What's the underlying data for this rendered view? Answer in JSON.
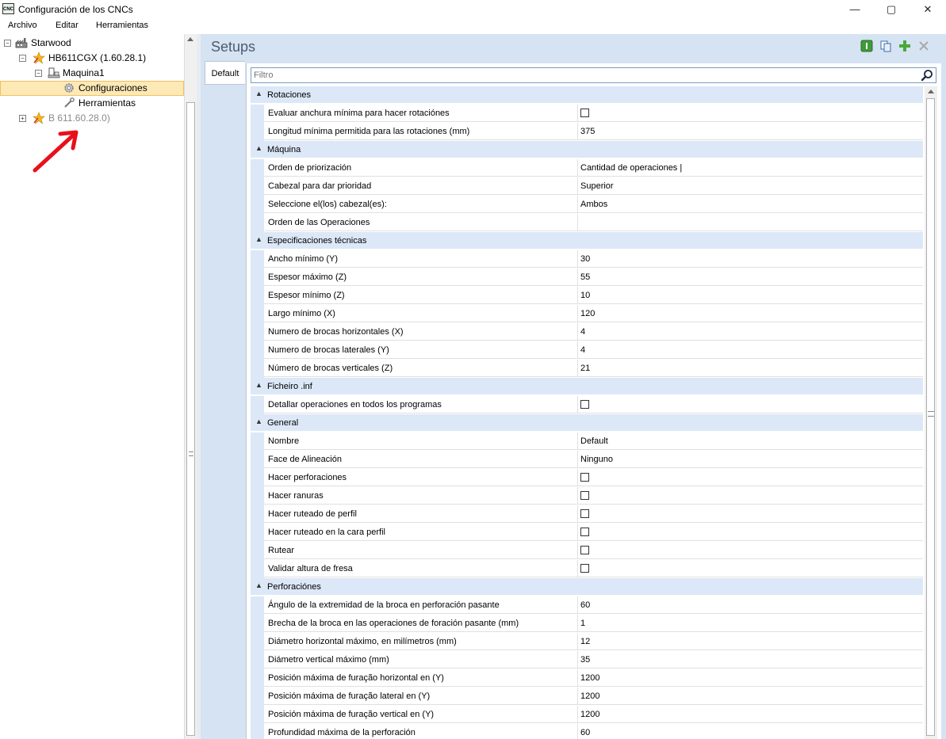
{
  "window": {
    "title": "Configuración de los CNCs",
    "icon_text": "CNC",
    "buttons": {
      "minimize": "—",
      "maximize": "▢",
      "close": "✕"
    }
  },
  "menu": {
    "items": [
      "Archivo",
      "Editar",
      "Herramientas"
    ]
  },
  "tree": {
    "nodes": [
      {
        "label": "Starwood",
        "icon": "factory-icon",
        "expander": "−"
      },
      {
        "label": "HB611CGX (1.60.28.1)",
        "icon": "star-icon",
        "expander": "−"
      },
      {
        "label": "Maquina1",
        "icon": "machine-icon",
        "expander": "−"
      },
      {
        "label": "Configuraciones",
        "icon": "gear-icon",
        "selected": true
      },
      {
        "label": "Herramientas",
        "icon": "tools-icon"
      },
      {
        "label": "B 611.60.28.0)",
        "icon": "star-icon",
        "expander": "+",
        "dimmed": true
      }
    ]
  },
  "panel": {
    "title": "Setups",
    "tab": "Default",
    "filter_placeholder": "Filtro",
    "header_icons": [
      "info-icon",
      "copy-icon",
      "add-icon",
      "delete-icon"
    ]
  },
  "sections": [
    {
      "title": "Rotaciones",
      "rows": [
        {
          "name": "Evaluar anchura mínima para hacer rotaciónes",
          "checkbox": true,
          "checked": false
        },
        {
          "name": "Longitud mínima permitida para las rotaciones (mm)",
          "value": "375"
        }
      ]
    },
    {
      "title": "Máquina",
      "rows": [
        {
          "name": "Orden de priorización",
          "value": "Cantidad de operaciones |"
        },
        {
          "name": "Cabezal para dar prioridad",
          "value": "Superior"
        },
        {
          "name": "Seleccione el(los) cabezal(es):",
          "value": "Ambos"
        },
        {
          "name": "Orden de las Operaciones",
          "value": ""
        }
      ]
    },
    {
      "title": "Especificaciones técnicas",
      "rows": [
        {
          "name": "Ancho mínimo (Y)",
          "value": "30"
        },
        {
          "name": "Espesor máximo (Z)",
          "value": "55"
        },
        {
          "name": "Espesor mínimo (Z)",
          "value": "10"
        },
        {
          "name": "Largo mínimo (X)",
          "value": "120"
        },
        {
          "name": "Numero de brocas horizontales (X)",
          "value": "4"
        },
        {
          "name": "Numero de brocas laterales (Y)",
          "value": "4"
        },
        {
          "name": "Número de brocas verticales (Z)",
          "value": "21"
        }
      ]
    },
    {
      "title": "Ficheiro .inf",
      "rows": [
        {
          "name": "Detallar operaciones en todos los programas",
          "checkbox": true,
          "checked": false
        }
      ]
    },
    {
      "title": "General",
      "rows": [
        {
          "name": "Nombre",
          "value": "Default"
        },
        {
          "name": "Face de Alineación",
          "value": "Ninguno"
        },
        {
          "name": "Hacer perforaciones",
          "checkbox": true,
          "checked": false
        },
        {
          "name": "Hacer ranuras",
          "checkbox": true,
          "checked": false
        },
        {
          "name": "Hacer ruteado de perfil",
          "checkbox": true,
          "checked": false
        },
        {
          "name": "Hacer ruteado en la cara perfil",
          "checkbox": true,
          "checked": false
        },
        {
          "name": "Rutear",
          "checkbox": true,
          "checked": false
        },
        {
          "name": "Validar altura de fresa",
          "checkbox": true,
          "checked": false
        }
      ]
    },
    {
      "title": "Perforaciónes",
      "rows": [
        {
          "name": "Ángulo de la extremidad de la broca en perforación pasante",
          "value": "60"
        },
        {
          "name": "Brecha de la broca en las operaciones de foración pasante (mm)",
          "value": "1"
        },
        {
          "name": "Diámetro horizontal máximo, en milímetros (mm)",
          "value": "12"
        },
        {
          "name": "Diámetro vertical máximo (mm)",
          "value": "35"
        },
        {
          "name": "Posición máxima de furação horizontal en (Y)",
          "value": "1200"
        },
        {
          "name": "Posición máxima de furação lateral en (Y)",
          "value": "1200"
        },
        {
          "name": "Posición máxima de furação vertical en (Y)",
          "value": "1200"
        },
        {
          "name": "Profundidad máxima de la perforación",
          "value": "60"
        }
      ]
    }
  ],
  "colors": {
    "panel_bg": "#d6e3f3",
    "section_bg": "#dce8f7",
    "selected_bg": "#fde9b6",
    "annotation_arrow": "#e8101a"
  }
}
